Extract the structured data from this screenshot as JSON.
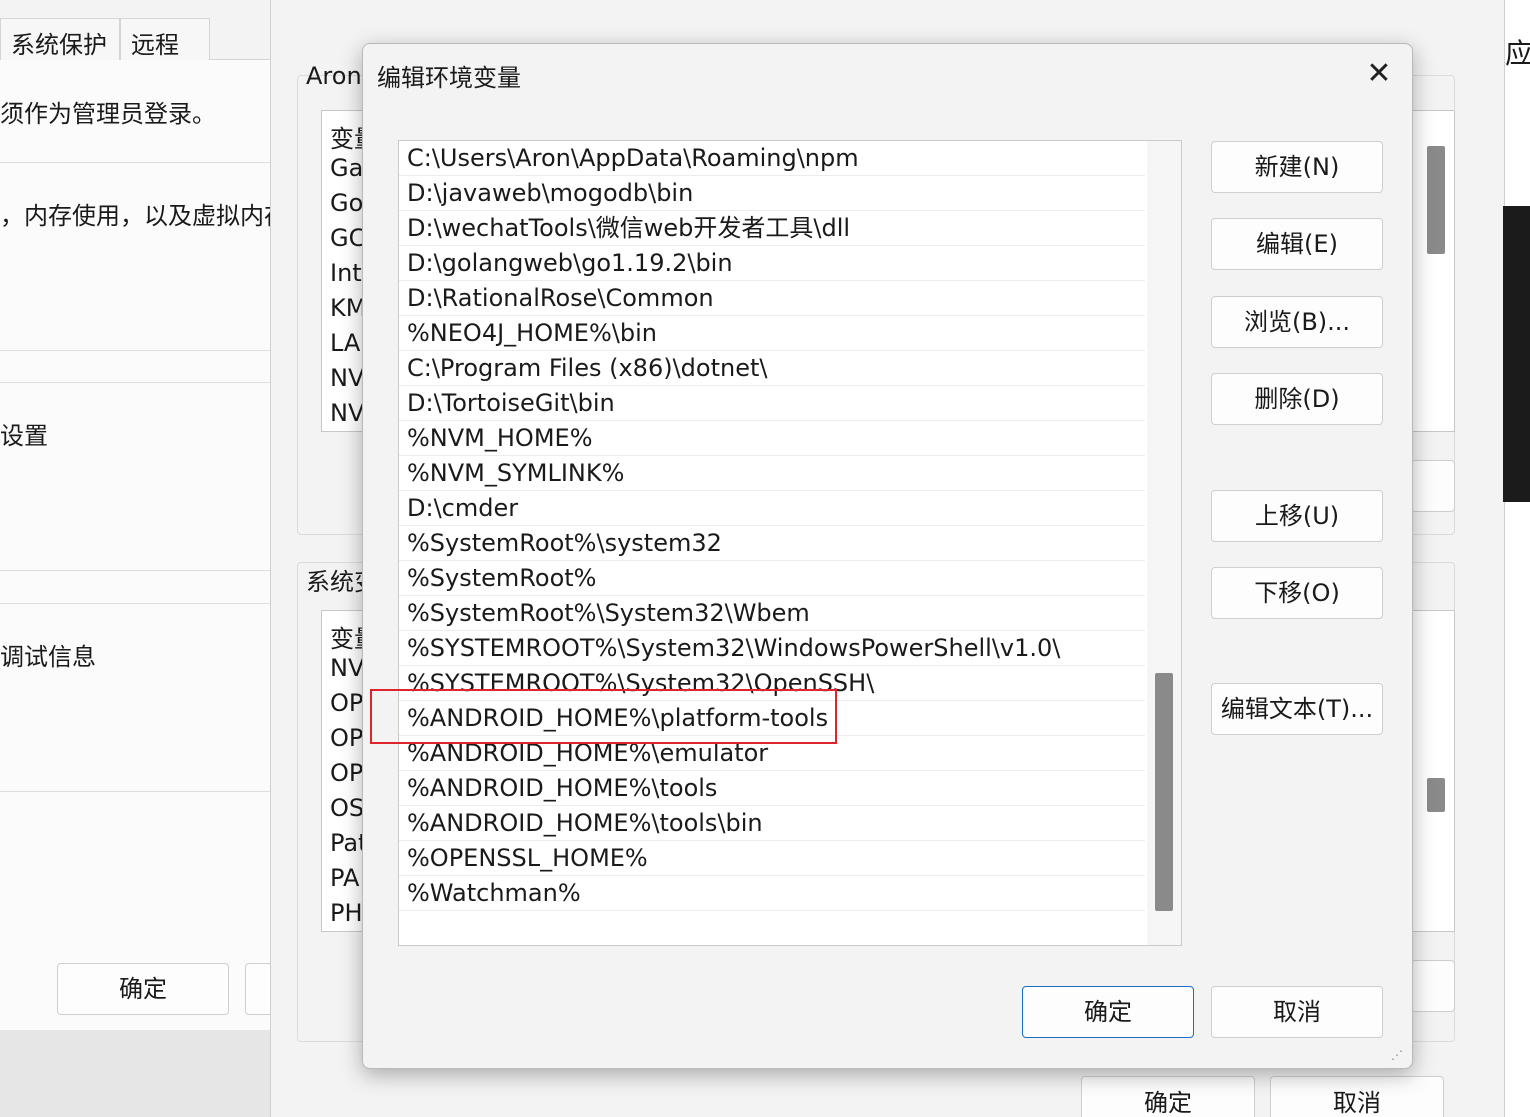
{
  "system_properties": {
    "tabs": [
      "系统保护",
      "远程"
    ],
    "lines": [
      "须作为管理员登录。",
      "，内存使用，以及虚拟内存",
      "设置",
      "调试信息"
    ],
    "ok_label": "确定",
    "bottom_fragment": "..."
  },
  "env_window": {
    "user_section_label": "Aron",
    "user_vars": [
      "变量",
      "Ga",
      "Go",
      "GC",
      "Inte",
      "KM",
      "LAI",
      "NV",
      "NV"
    ],
    "system_section_label": "系统变",
    "system_vars": [
      "变量",
      "NV",
      "OP",
      "OP",
      "OP",
      "OS",
      "Pat",
      "PA",
      "PH"
    ],
    "ok_label": "确定",
    "cancel_label": "取消",
    "right_fragment": "应"
  },
  "dialog": {
    "title": "编辑环境变量",
    "close_icon": "close-icon",
    "entries": [
      "C:\\Users\\Aron\\AppData\\Roaming\\npm",
      "D:\\javaweb\\mogodb\\bin",
      "D:\\wechatTools\\微信web开发者工具\\dll",
      "D:\\golangweb\\go1.19.2\\bin",
      "D:\\RationalRose\\Common",
      "%NEO4J_HOME%\\bin",
      "C:\\Program Files (x86)\\dotnet\\",
      "D:\\TortoiseGit\\bin",
      "%NVM_HOME%",
      "%NVM_SYMLINK%",
      "D:\\cmder",
      "%SystemRoot%\\system32",
      "%SystemRoot%",
      "%SystemRoot%\\System32\\Wbem",
      "%SYSTEMROOT%\\System32\\WindowsPowerShell\\v1.0\\",
      "%SYSTEMROOT%\\System32\\OpenSSH\\",
      "%ANDROID_HOME%\\platform-tools",
      "%ANDROID_HOME%\\emulator",
      "%ANDROID_HOME%\\tools",
      "%ANDROID_HOME%\\tools\\bin",
      "%OPENSSL_HOME%",
      "%Watchman%"
    ],
    "highlighted_entry_index": 16,
    "buttons": {
      "new": "新建(N)",
      "edit": "编辑(E)",
      "browse": "浏览(B)...",
      "delete": "删除(D)",
      "move_up": "上移(U)",
      "move_down": "下移(O)",
      "edit_text": "编辑文本(T)..."
    },
    "ok_label": "确定",
    "cancel_label": "取消",
    "highlight_color": "#e0242b",
    "accent_color": "#1a6fc4"
  }
}
